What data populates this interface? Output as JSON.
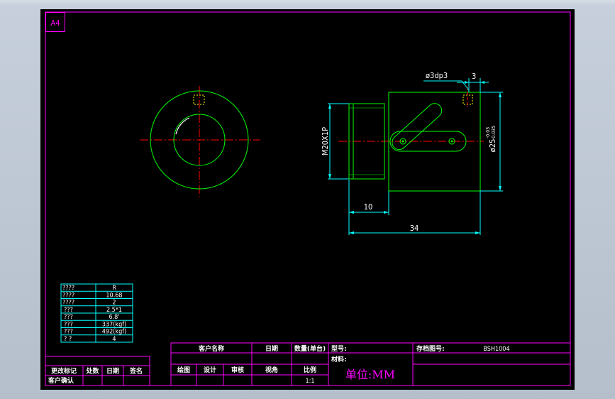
{
  "colors": {
    "frame": "#ff00ff",
    "outline": "#00ff00",
    "centerline": "#ff0000",
    "hidden": "#ffff00",
    "dimension": "#00ffff",
    "text": "#ffffff",
    "title_text": "#ff00ff",
    "viewport_bg": "#000000"
  },
  "sheet": {
    "size_label": "A4"
  },
  "dimensions": {
    "hole_callout": "ø3dp3",
    "hole_offset": "3",
    "thread": "M20X1P",
    "diameter": "ø25",
    "tol_upper": "-0.03",
    "tol_lower": "-0.035",
    "thread_length": "10",
    "overall_length": "34"
  },
  "spec_table": {
    "rows": [
      {
        "label": "????",
        "value": "R"
      },
      {
        "label": "????",
        "value": "10.68"
      },
      {
        "label": "????",
        "value": "2"
      },
      {
        "label": "???",
        "value": "2.5*1"
      },
      {
        "label": "???",
        "value": "6.8'"
      },
      {
        "label": "???",
        "value": "337(kgf)"
      },
      {
        "label": "???",
        "value": "492(kgf)"
      },
      {
        "label": "?  ?",
        "value": "4"
      }
    ]
  },
  "revision_block": {
    "change_mark": "更改标记",
    "count": "处数",
    "date": "日期",
    "signature": "签名",
    "customer_confirm": "客户确认"
  },
  "title_block": {
    "customer_name": "客户名称",
    "date": "日期",
    "quantity": "数量(单台)",
    "model": "型号:",
    "material": "材料:",
    "drawing_no_label": "存档图号:",
    "drawing_no": "BSH1004",
    "drawn": "绘图",
    "design": "设计",
    "review": "审核",
    "view": "视角",
    "scale_label": "比例",
    "scale": "1:1",
    "unit": "单位:MM"
  }
}
